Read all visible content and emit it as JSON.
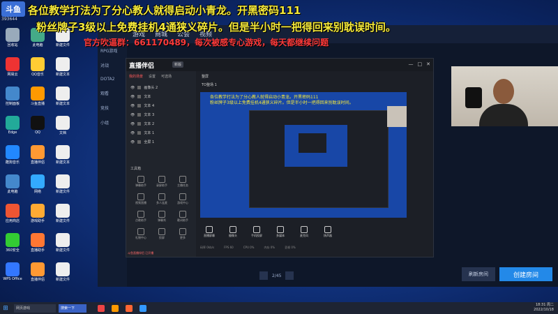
{
  "banner": {
    "line1": "各位教学打法为了分心教人就得启动小青龙。开黑密码111",
    "line2": "粉丝牌子3级以上免费挂机4通狭义碎片。但是半小时一把得回来别耽误时间。",
    "line3": "官方吹逼群：661170489，每次被感专心游戏，每天都继续问题"
  },
  "top_logo": {
    "text": "斗鱼",
    "sub": "393644"
  },
  "desktop_icons": [
    {
      "label": "回收站",
      "color": "#9ab"
    },
    {
      "label": "此电脑",
      "color": "#4a8"
    },
    {
      "label": "新建文件",
      "color": "#eee"
    },
    {
      "label": "网易云",
      "color": "#e33"
    },
    {
      "label": "QQ音乐",
      "color": "#fc3"
    },
    {
      "label": "新建文本",
      "color": "#eee"
    },
    {
      "label": "控制面板",
      "color": "#48c"
    },
    {
      "label": "斗鱼直播",
      "color": "#f90"
    },
    {
      "label": "新建文本",
      "color": "#eee"
    },
    {
      "label": "Edge",
      "color": "#2a9"
    },
    {
      "label": "QQ",
      "color": "#111"
    },
    {
      "label": "文档",
      "color": "#eee"
    },
    {
      "label": "酷狗音乐",
      "color": "#28f"
    },
    {
      "label": "直播伴侣",
      "color": "#f93"
    },
    {
      "label": "新建文本",
      "color": "#eee"
    },
    {
      "label": "此电脑",
      "color": "#48c"
    },
    {
      "label": "网络",
      "color": "#3af"
    },
    {
      "label": "新建文件",
      "color": "#eee"
    },
    {
      "label": "应用商店",
      "color": "#e53"
    },
    {
      "label": "游戏助手",
      "color": "#fa3"
    },
    {
      "label": "新建文件",
      "color": "#eee"
    },
    {
      "label": "360安全",
      "color": "#3c3"
    },
    {
      "label": "直播助手",
      "color": "#f73"
    },
    {
      "label": "新建文件",
      "color": "#eee"
    },
    {
      "label": "WPS Office",
      "color": "#37f"
    },
    {
      "label": "直播伴侣",
      "color": "#f93"
    },
    {
      "label": "新建文件",
      "color": "#eee"
    }
  ],
  "launcher": {
    "nav": [
      "游戏",
      "商城",
      "公会",
      "视频"
    ],
    "side": [
      "RPG游戏",
      "对战",
      "DOTA2",
      "观看",
      "竞技",
      "小组"
    ],
    "refresh": "刷新房间",
    "create": "创建房间",
    "pager": "2/45"
  },
  "app": {
    "name": "直播伴侣",
    "version": "新版",
    "tabs": [
      "我的场景",
      "设置",
      "可选场"
    ],
    "scenes": [
      "画像头 2",
      "文本",
      "文本 4",
      "文本 3",
      "文本 2",
      "文本 1",
      "全屏 1"
    ],
    "tools_title": "工具箱",
    "tools": [
      "弹幕助手",
      "录屏助手",
      "主播任务",
      "视频直播",
      "多人连麦",
      "游戏中心",
      "点歌助手",
      "弹幕秀",
      "歌词助手",
      "礼物中心",
      "投屏",
      "更多"
    ],
    "status": "斗鱼直播伴侣 已开播",
    "header": "整屏",
    "header2": "TO整场 1",
    "preview_line1": "各位教学打法为了分心教人就得启动小青龙。开黑密码111",
    "preview_line2": "粉丝牌子3级以上免费挂机4通狭义碎片。但是半小时一把得回来别耽误时间。",
    "controls": [
      "直播屏幕",
      "摄像头",
      "手机投屏",
      "多媒体",
      "麦克风",
      "扬声器"
    ],
    "stats": [
      "码率 0kb/s",
      "FPS 60",
      "CPU 0%",
      "内存 0%",
      "丢帧 0%"
    ]
  },
  "taskbar": {
    "start": "⊞",
    "search": "网页游戏",
    "search2": "搜索一下",
    "time": "18:31 周二",
    "date": "2022/10/18"
  }
}
